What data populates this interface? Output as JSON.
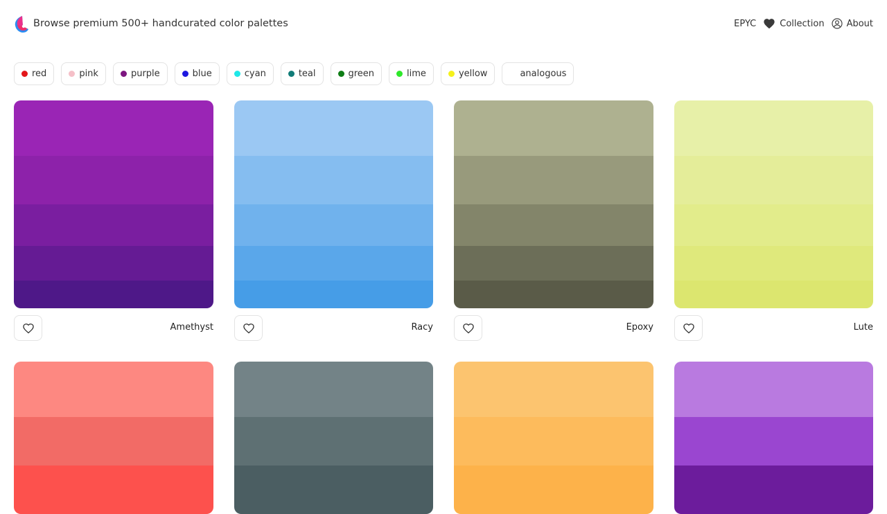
{
  "header": {
    "tagline": "Browse premium 500+ handcurated color palettes",
    "nav": {
      "brand": "EPYC",
      "collection": "Collection",
      "about": "About"
    }
  },
  "filters": [
    {
      "label": "red",
      "color": "#e3171b"
    },
    {
      "label": "pink",
      "color": "#f5c0c8"
    },
    {
      "label": "purple",
      "color": "#7d1680"
    },
    {
      "label": "blue",
      "color": "#1d18e0"
    },
    {
      "label": "cyan",
      "color": "#1fe8e8"
    },
    {
      "label": "teal",
      "color": "#117c78"
    },
    {
      "label": "green",
      "color": "#0f7d16"
    },
    {
      "label": "lime",
      "color": "#2ee82a"
    },
    {
      "label": "yellow",
      "color": "#f5f11b"
    },
    {
      "label": "analogous",
      "color": ""
    }
  ],
  "palettes": [
    {
      "name": "Amethyst",
      "colors": [
        "#9a25b5",
        "#8d22aa",
        "#7a1ea0",
        "#651b94",
        "#4e1888"
      ]
    },
    {
      "name": "Racy",
      "colors": [
        "#9bc8f3",
        "#85bdf0",
        "#70b2ed",
        "#5aa7ea",
        "#469de7"
      ]
    },
    {
      "name": "Epoxy",
      "colors": [
        "#aeb190",
        "#989a7c",
        "#83856a",
        "#6c6e58",
        "#5a5b48"
      ]
    },
    {
      "name": "Lute",
      "colors": [
        "#e7f0a8",
        "#e4ed99",
        "#e2ec8b",
        "#dfe97c",
        "#dce66f"
      ]
    },
    {
      "name": "",
      "colors": [
        "#fd8881",
        "#f26b66",
        "#fd514d"
      ]
    },
    {
      "name": "",
      "colors": [
        "#738387",
        "#5e7073",
        "#4b5e62"
      ]
    },
    {
      "name": "",
      "colors": [
        "#fcc46f",
        "#fdbb5c",
        "#fdb24a"
      ]
    },
    {
      "name": "",
      "colors": [
        "#b97ae0",
        "#9a46d0",
        "#6c1c9c"
      ]
    }
  ]
}
